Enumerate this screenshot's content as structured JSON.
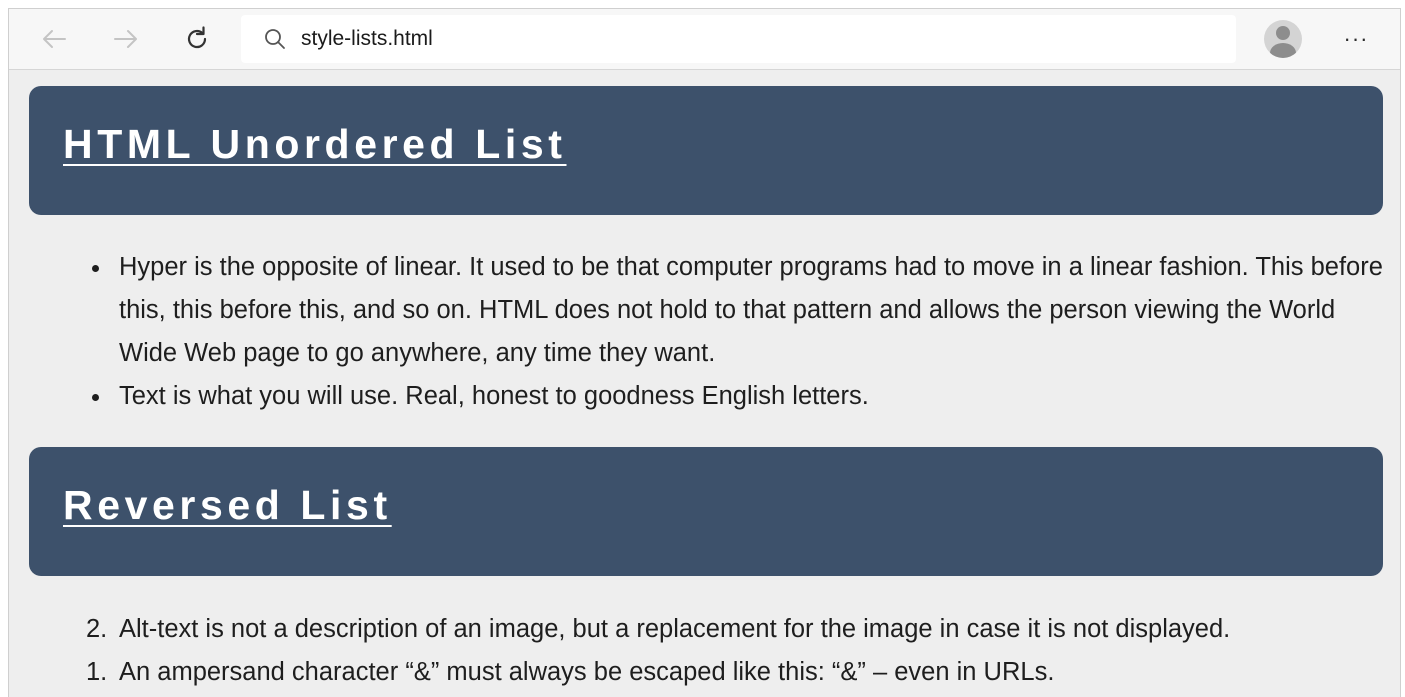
{
  "browser": {
    "url": "style-lists.html",
    "icons": {
      "back": "arrow-left-icon",
      "forward": "arrow-right-icon",
      "reload": "reload-icon",
      "search": "search-icon",
      "profile": "profile-avatar-icon",
      "more": "more-options-icon"
    },
    "more_label": "···"
  },
  "page": {
    "sections": [
      {
        "heading": "HTML Unordered List",
        "items": [
          "Hyper is the opposite of linear. It used to be that computer programs had to move in a linear fashion. This before this, this before this, and so on. HTML does not hold to that pattern and allows the person viewing the World Wide Web page to go anywhere, any time they want.",
          "Text is what you will use. Real, honest to goodness English letters."
        ]
      },
      {
        "heading": "Reversed List",
        "items": [
          {
            "number": "2.",
            "text": "Alt-text is not a description of an image, but a replacement for the image in case it is not displayed."
          },
          {
            "number": "1.",
            "text": "An ampersand character “&” must always be escaped like this: “&” – even in URLs."
          }
        ]
      }
    ],
    "colors": {
      "banner": "#3d516b",
      "banner_text": "#ffffff",
      "page_background": "#eeeeee",
      "body_text": "#1e1e1e"
    }
  }
}
